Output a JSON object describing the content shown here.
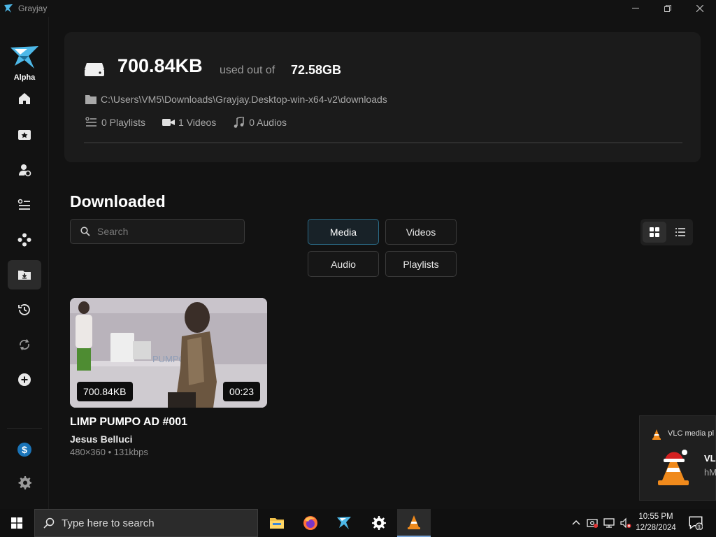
{
  "window": {
    "title": "Grayjay",
    "controls": [
      "minimize-icon",
      "maximize-icon",
      "close-icon"
    ]
  },
  "sidebar": {
    "logo_text": "Alpha",
    "items": [
      {
        "name": "home",
        "icon": "home-icon"
      },
      {
        "name": "subscriptions",
        "icon": "subscriptions-icon"
      },
      {
        "name": "creators",
        "icon": "creators-icon"
      },
      {
        "name": "playlists",
        "icon": "playlist-icon"
      },
      {
        "name": "sources",
        "icon": "sources-icon"
      },
      {
        "name": "downloads",
        "icon": "download-folder-icon",
        "active": true
      },
      {
        "name": "history",
        "icon": "history-icon"
      },
      {
        "name": "sync",
        "icon": "sync-icon"
      },
      {
        "name": "add",
        "icon": "add-icon"
      },
      {
        "name": "donate",
        "icon": "dollar-icon"
      },
      {
        "name": "settings",
        "icon": "gear-icon"
      }
    ]
  },
  "storage": {
    "used": "700.84KB",
    "used_label": "used out of",
    "total": "72.58GB",
    "path": "C:\\Users\\VM5\\Downloads\\Grayjay.Desktop-win-x64-v2\\downloads",
    "playlists": "0 Playlists",
    "videos": "1 Videos",
    "audios": "0 Audios",
    "used_fraction": 1e-05
  },
  "downloads": {
    "title": "Downloaded",
    "search_placeholder": "Search",
    "filters": [
      {
        "label": "Media",
        "active": true
      },
      {
        "label": "Videos",
        "active": false
      },
      {
        "label": "Audio",
        "active": false
      },
      {
        "label": "Playlists",
        "active": false
      }
    ],
    "view_mode": "grid",
    "items": [
      {
        "title": "LIMP PUMPO AD #001",
        "author": "Jesus Belluci",
        "meta": "480×360 • 131kbps",
        "size": "700.84KB",
        "duration": "00:23"
      }
    ]
  },
  "toast": {
    "app": "VLC media pl",
    "title": "VL",
    "body": "hM"
  },
  "taskbar": {
    "search_placeholder": "Type here to search",
    "apps": [
      "file-explorer-icon",
      "firefox-icon",
      "grayjay-icon",
      "settings-icon",
      "vlc-icon"
    ],
    "time": "10:55 PM",
    "date": "12/28/2024",
    "notification_count": "1"
  },
  "colors": {
    "accent": "#2a6a86",
    "background": "#121212",
    "card": "#1b1b1b",
    "logo_blue": "#4db8e8"
  }
}
